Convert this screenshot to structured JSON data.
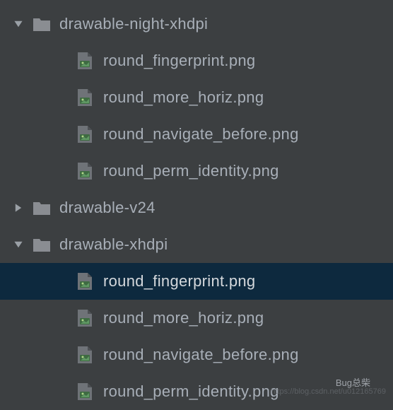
{
  "tree": {
    "items": [
      {
        "type": "folder",
        "label": "drawable-night-xhdpi",
        "expanded": true,
        "level": 1
      },
      {
        "type": "file",
        "label": "round_fingerprint.png",
        "level": 2
      },
      {
        "type": "file",
        "label": "round_more_horiz.png",
        "level": 2
      },
      {
        "type": "file",
        "label": "round_navigate_before.png",
        "level": 2
      },
      {
        "type": "file",
        "label": "round_perm_identity.png",
        "level": 2
      },
      {
        "type": "folder",
        "label": "drawable-v24",
        "expanded": false,
        "level": 1
      },
      {
        "type": "folder",
        "label": "drawable-xhdpi",
        "expanded": true,
        "level": 1
      },
      {
        "type": "file",
        "label": "round_fingerprint.png",
        "level": 2,
        "selected": true
      },
      {
        "type": "file",
        "label": "round_more_horiz.png",
        "level": 2
      },
      {
        "type": "file",
        "label": "round_navigate_before.png",
        "level": 2
      },
      {
        "type": "file",
        "label": "round_perm_identity.png",
        "level": 2
      }
    ]
  },
  "watermark": {
    "url": "https://blog.csdn.net/u012165769",
    "bug": "Bug总柴"
  }
}
